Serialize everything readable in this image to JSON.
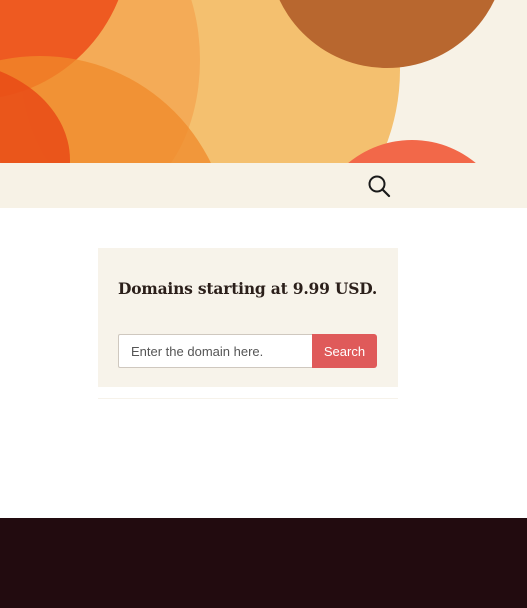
{
  "header": {
    "accent_colors": {
      "peach": "#f4c06f",
      "brown": "#b8672f",
      "red_orange": "#ee5a21",
      "orange": "#f08a2a",
      "coral": "#f26849",
      "cream": "#f7f2e6"
    }
  },
  "navbar": {
    "search_icon": "search-icon"
  },
  "domain_widget": {
    "title": "Domains starting at 9.99 USD.",
    "input_placeholder": "Enter the domain here.",
    "input_value": "",
    "button_label": "Search",
    "button_color": "#df5a5a"
  },
  "footer": {
    "background_color": "#220b0f"
  }
}
